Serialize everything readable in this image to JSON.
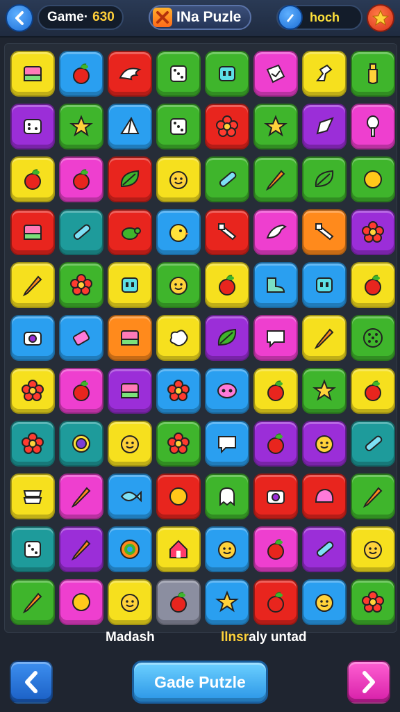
{
  "header": {
    "score_label": "Game·",
    "score_value": "630",
    "title": "INa Puzle",
    "hint_label": "hoch"
  },
  "footer": {
    "left_caption": "Madash",
    "right_caption_highlight": "llnsr",
    "right_caption_rest": "aly untad",
    "main_button": "Gade Putzle"
  },
  "colors": {
    "Y": "#f6e01e",
    "B": "#2a9ff0",
    "R": "#e8251e",
    "G": "#3fb52c",
    "P": "#9b2ed8",
    "M": "#ee3fcf",
    "O": "#ff8a1c",
    "T": "#1e9b9b",
    "S": "#8b8ea0"
  },
  "board": {
    "rows": [
      [
        [
          "Y",
          "card"
        ],
        [
          "B",
          "apple"
        ],
        [
          "R",
          "wing"
        ],
        [
          "G",
          "dice"
        ],
        [
          "G",
          "box"
        ],
        [
          "M",
          "paper"
        ],
        [
          "Y",
          "arm"
        ],
        [
          "G",
          "bottle"
        ]
      ],
      [
        [
          "P",
          "dice2"
        ],
        [
          "G",
          "star"
        ],
        [
          "B",
          "tent"
        ],
        [
          "G",
          "dice"
        ],
        [
          "R",
          "flower"
        ],
        [
          "G",
          "star"
        ],
        [
          "P",
          "shard"
        ],
        [
          "M",
          "spoon"
        ]
      ],
      [
        [
          "Y",
          "apple"
        ],
        [
          "M",
          "apple"
        ],
        [
          "R",
          "leaf"
        ],
        [
          "Y",
          "face"
        ],
        [
          "G",
          "stick"
        ],
        [
          "G",
          "pencil"
        ],
        [
          "G",
          "leaf"
        ],
        [
          "G",
          "coin"
        ]
      ],
      [
        [
          "R",
          "card"
        ],
        [
          "T",
          "stick"
        ],
        [
          "R",
          "turtle"
        ],
        [
          "B",
          "chick"
        ],
        [
          "R",
          "tool"
        ],
        [
          "M",
          "bird"
        ],
        [
          "O",
          "tool"
        ],
        [
          "P",
          "flower"
        ]
      ],
      [
        [
          "Y",
          "pencil"
        ],
        [
          "G",
          "flower"
        ],
        [
          "Y",
          "box"
        ],
        [
          "G",
          "face"
        ],
        [
          "Y",
          "apple"
        ],
        [
          "B",
          "shoe"
        ],
        [
          "B",
          "box"
        ],
        [
          "Y",
          "apple"
        ]
      ],
      [
        [
          "B",
          "camera"
        ],
        [
          "B",
          "eraser"
        ],
        [
          "O",
          "card"
        ],
        [
          "Y",
          "blob"
        ],
        [
          "P",
          "leaf"
        ],
        [
          "M",
          "chat"
        ],
        [
          "Y",
          "pencil"
        ],
        [
          "G",
          "dots"
        ]
      ],
      [
        [
          "Y",
          "flower"
        ],
        [
          "M",
          "apple"
        ],
        [
          "P",
          "card"
        ],
        [
          "B",
          "flower"
        ],
        [
          "B",
          "eyes"
        ],
        [
          "Y",
          "apple"
        ],
        [
          "G",
          "star"
        ],
        [
          "Y",
          "apple"
        ]
      ],
      [
        [
          "T",
          "flower"
        ],
        [
          "T",
          "eye"
        ],
        [
          "Y",
          "face"
        ],
        [
          "G",
          "flower"
        ],
        [
          "B",
          "chat"
        ],
        [
          "P",
          "apple"
        ],
        [
          "P",
          "face"
        ],
        [
          "T",
          "stick"
        ]
      ],
      [
        [
          "Y",
          "cloth"
        ],
        [
          "M",
          "pencil"
        ],
        [
          "B",
          "fish"
        ],
        [
          "R",
          "coin"
        ],
        [
          "G",
          "ghost"
        ],
        [
          "R",
          "camera"
        ],
        [
          "R",
          "shell"
        ],
        [
          "G",
          "pencil"
        ]
      ],
      [
        [
          "T",
          "dice"
        ],
        [
          "P",
          "pencil"
        ],
        [
          "B",
          "swirl"
        ],
        [
          "Y",
          "house"
        ],
        [
          "B",
          "face"
        ],
        [
          "M",
          "apple"
        ],
        [
          "P",
          "stick"
        ],
        [
          "Y",
          "face"
        ]
      ],
      [
        [
          "G",
          "pencil"
        ],
        [
          "M",
          "coin"
        ],
        [
          "Y",
          "face"
        ],
        [
          "S",
          "apple"
        ],
        [
          "B",
          "star"
        ],
        [
          "R",
          "apple"
        ],
        [
          "B",
          "face"
        ],
        [
          "G",
          "flower"
        ]
      ]
    ]
  }
}
